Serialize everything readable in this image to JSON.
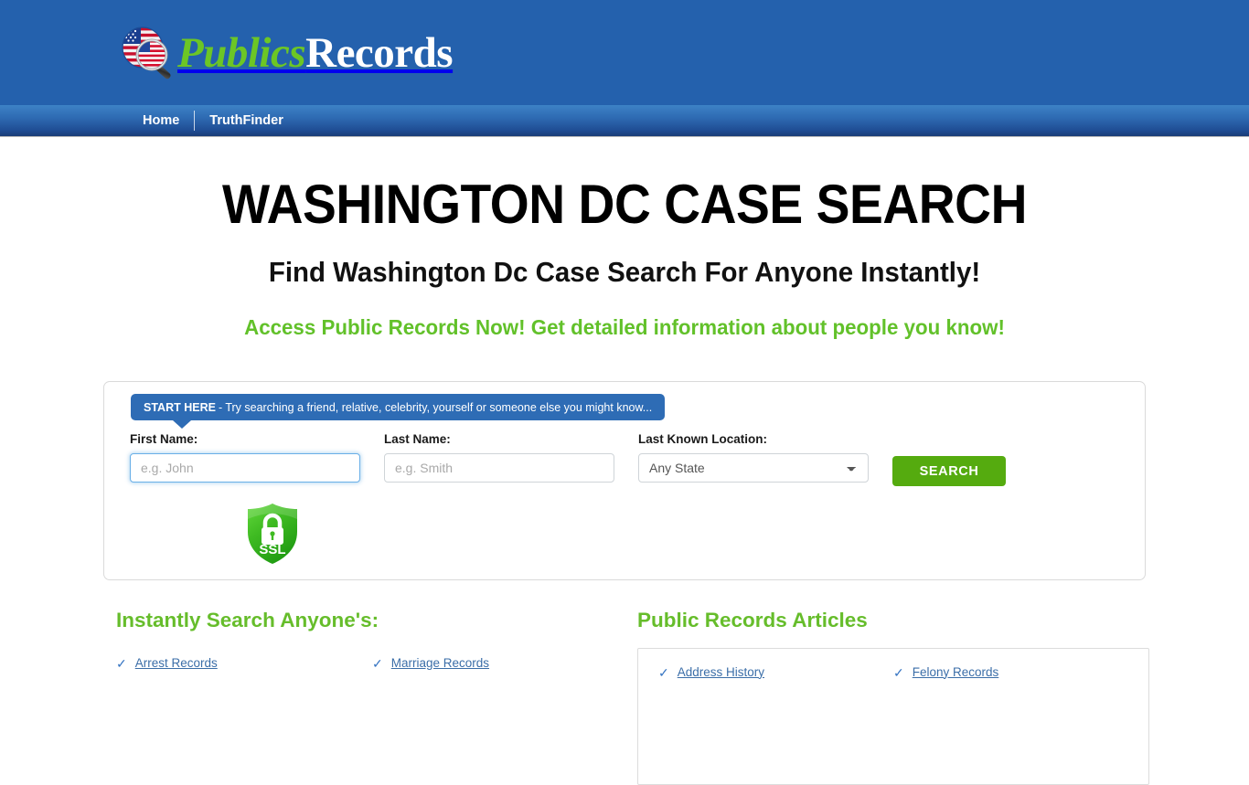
{
  "header": {
    "logo": {
      "icon": "flag-magnifier-icon",
      "text_green": "Publics",
      "text_white": "Records"
    }
  },
  "nav": {
    "items": [
      {
        "label": "Home",
        "name": "nav-item-home"
      },
      {
        "label": "TruthFinder",
        "name": "nav-item-truthfinder"
      }
    ]
  },
  "hero": {
    "title": "WASHINGTON DC CASE SEARCH",
    "subtitle": "Find Washington Dc Case Search For Anyone Instantly!",
    "tagline": "Access Public Records Now! Get detailed information about people you know!"
  },
  "search_panel": {
    "banner_strong": "START HERE",
    "banner_text": "- Try searching a friend, relative, celebrity, yourself or someone else you might know...",
    "first_name": {
      "label": "First Name:",
      "value": "",
      "placeholder": "e.g. John"
    },
    "last_name": {
      "label": "Last Name:",
      "value": "",
      "placeholder": "e.g. Smith"
    },
    "location": {
      "label": "Last Known Location:",
      "selected": "Any State"
    },
    "search_button": "SEARCH",
    "ssl_badge": {
      "icon": "ssl-shield-lock-icon",
      "label": "SSL"
    }
  },
  "instant_search": {
    "title": "Instantly Search Anyone's:",
    "links": [
      "Arrest Records",
      "Marriage Records"
    ]
  },
  "articles": {
    "title": "Public Records Articles",
    "links": [
      "Address History",
      "Felony Records"
    ]
  },
  "colors": {
    "header_blue": "#2461ad",
    "nav_blue_top": "#3d82c6",
    "nav_blue_bottom": "#1b3c77",
    "accent_green": "#66bd2b",
    "button_green": "#55ab0f",
    "link_blue": "#3b6ea8",
    "banner_blue": "#2e6cb5"
  }
}
